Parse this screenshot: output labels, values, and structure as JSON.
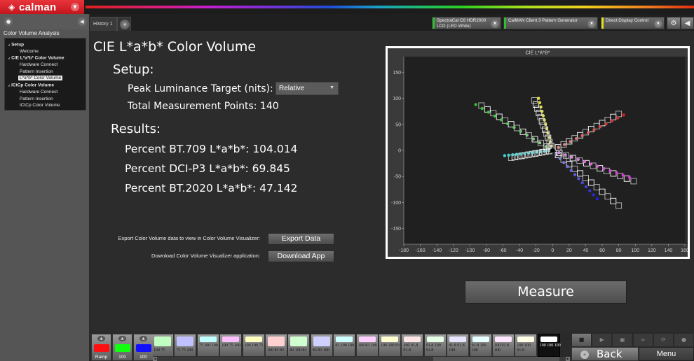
{
  "app": {
    "brand": "calman",
    "brand_color": "#d9232a",
    "brand_menu_icon": "chevron-down-icon"
  },
  "sidebar": {
    "title": "Color Volume Analysis",
    "tree": [
      {
        "label": "Setup",
        "level": 0
      },
      {
        "label": "Welcome",
        "level": 1
      },
      {
        "label": "CIE L*a*b* Color Volume",
        "level": 0
      },
      {
        "label": "Hardware Connect",
        "level": 1
      },
      {
        "label": "Pattern Insertion",
        "level": 1
      },
      {
        "label": "L*a*b* Color Volume",
        "level": 1,
        "selected": true
      },
      {
        "label": "ICtCp Color Volume",
        "level": 0
      },
      {
        "label": "Hardware Connect",
        "level": 1
      },
      {
        "label": "Pattern Insertion",
        "level": 1
      },
      {
        "label": "ICtCp Color Volume",
        "level": 1
      }
    ]
  },
  "tabs": {
    "history_label": "History 1",
    "add_icon": "plus-icon"
  },
  "devices": [
    {
      "line1": "SpectraCal C6 HDR2000",
      "line2": "LCD (LED White)",
      "status_color": "#2ec02e"
    },
    {
      "line1": "CalMAN Client 3 Pattern Generator",
      "line2": "",
      "status_color": "#2ec02e"
    },
    {
      "line1": "Direct Display Control",
      "line2": "",
      "status_color": "#e0e020"
    }
  ],
  "toolbar_icons": {
    "settings": "gear-icon",
    "collapse": "chevron-left-icon"
  },
  "page": {
    "title": "CIE L*a*b* Color Volume",
    "setup_heading": "Setup:",
    "peak_label": "Peak Luminance Target (nits):",
    "peak_value": "Relative",
    "total_points_label": "Total Measurement Points: 140",
    "results_heading": "Results:",
    "results": [
      "Percent BT.709 L*a*b*: 104.014",
      "Percent DCI-P3 L*a*b*: 69.845",
      "Percent BT.2020 L*a*b*: 47.142"
    ],
    "export_label": "Export Color Volume data to view in Color Volume Visualizer:",
    "export_button": "Export Data",
    "download_label": "Download Color Volume Visualizer application:",
    "download_button": "Download App",
    "measure_button": "Measure"
  },
  "chart_data": {
    "type": "scatter",
    "title": "CIE L*A*B*",
    "xlabel": "",
    "ylabel": "",
    "xlim": [
      -180,
      160
    ],
    "ylim": [
      -180,
      180
    ],
    "xticks": [
      -180,
      -160,
      -140,
      -120,
      -100,
      -80,
      -60,
      -40,
      -20,
      0,
      20,
      40,
      60,
      80,
      100,
      120,
      140,
      160
    ],
    "yticks": [
      150,
      100,
      50,
      0,
      -50,
      -100,
      -150
    ],
    "grid": false,
    "legend": "none",
    "series": [
      {
        "name": "Red",
        "color": "#d42020",
        "measured_end": [
          86,
          68
        ],
        "target_end": [
          80,
          70
        ],
        "steps": 12
      },
      {
        "name": "Green",
        "color": "#30c030",
        "measured_end": [
          -93,
          88
        ],
        "target_end": [
          -86,
          86
        ],
        "steps": 12
      },
      {
        "name": "Blue",
        "color": "#2020d8",
        "measured_end": [
          54,
          -93
        ],
        "target_end": [
          80,
          -106
        ],
        "steps": 12
      },
      {
        "name": "Cyan",
        "color": "#40d0d0",
        "measured_end": [
          -58,
          -10
        ],
        "target_end": [
          -50,
          -14
        ],
        "steps": 12
      },
      {
        "name": "Magenta",
        "color": "#d030d0",
        "measured_end": [
          93,
          -52
        ],
        "target_end": [
          98,
          -59
        ],
        "steps": 12
      },
      {
        "name": "Yellow",
        "color": "#e0e040",
        "measured_end": [
          -17,
          100
        ],
        "target_end": [
          -22,
          96
        ],
        "steps": 12
      }
    ]
  },
  "bottom": {
    "ramps": [
      {
        "label": "Ramp",
        "color": "#ff1010"
      },
      {
        "label": "100",
        "color": "#10ff10"
      },
      {
        "label": "100",
        "color": "#1010ff"
      }
    ],
    "patches": [
      {
        "label": "100 75",
        "color": "#c0ffc0",
        "big": true
      },
      {
        "label": "75 75 100",
        "color": "#c0c0ff",
        "big": true
      },
      {
        "label": "75 100 100",
        "color": "#c0ffff"
      },
      {
        "label": "100 75 100",
        "color": "#ffc0ff"
      },
      {
        "label": "100 100 75",
        "color": "#ffffc0"
      },
      {
        "label": "100 83 83",
        "color": "#ffd0d0",
        "big": true
      },
      {
        "label": "83 100 83",
        "color": "#d0ffd0",
        "big": true
      },
      {
        "label": "83 83 100",
        "color": "#d0d0ff",
        "big": true
      },
      {
        "label": "83 100 100",
        "color": "#d0ffff"
      },
      {
        "label": "100 83 100",
        "color": "#ffd0ff"
      },
      {
        "label": "100 100 83",
        "color": "#ffffd0"
      },
      {
        "label": "100 91.8 91.8",
        "color": "#ffe6e6"
      },
      {
        "label": "91.8 100 91.8",
        "color": "#e6ffe6"
      },
      {
        "label": "91.8 91.8 100",
        "color": "#e6e6ff"
      },
      {
        "label": "91.8 100 100",
        "color": "#e6ffff"
      },
      {
        "label": "100 91.8 100",
        "color": "#ffe6ff"
      },
      {
        "label": "100 100 91.8",
        "color": "#ffffe6"
      },
      {
        "label": "100 100 100",
        "color": "#ffffff",
        "active": true
      }
    ],
    "controls": [
      "stop-icon",
      "play-icon",
      "save-icon",
      "loop-icon",
      "refresh-icon",
      "record-icon"
    ],
    "back_button": "Back",
    "menu_button": "Menu"
  }
}
